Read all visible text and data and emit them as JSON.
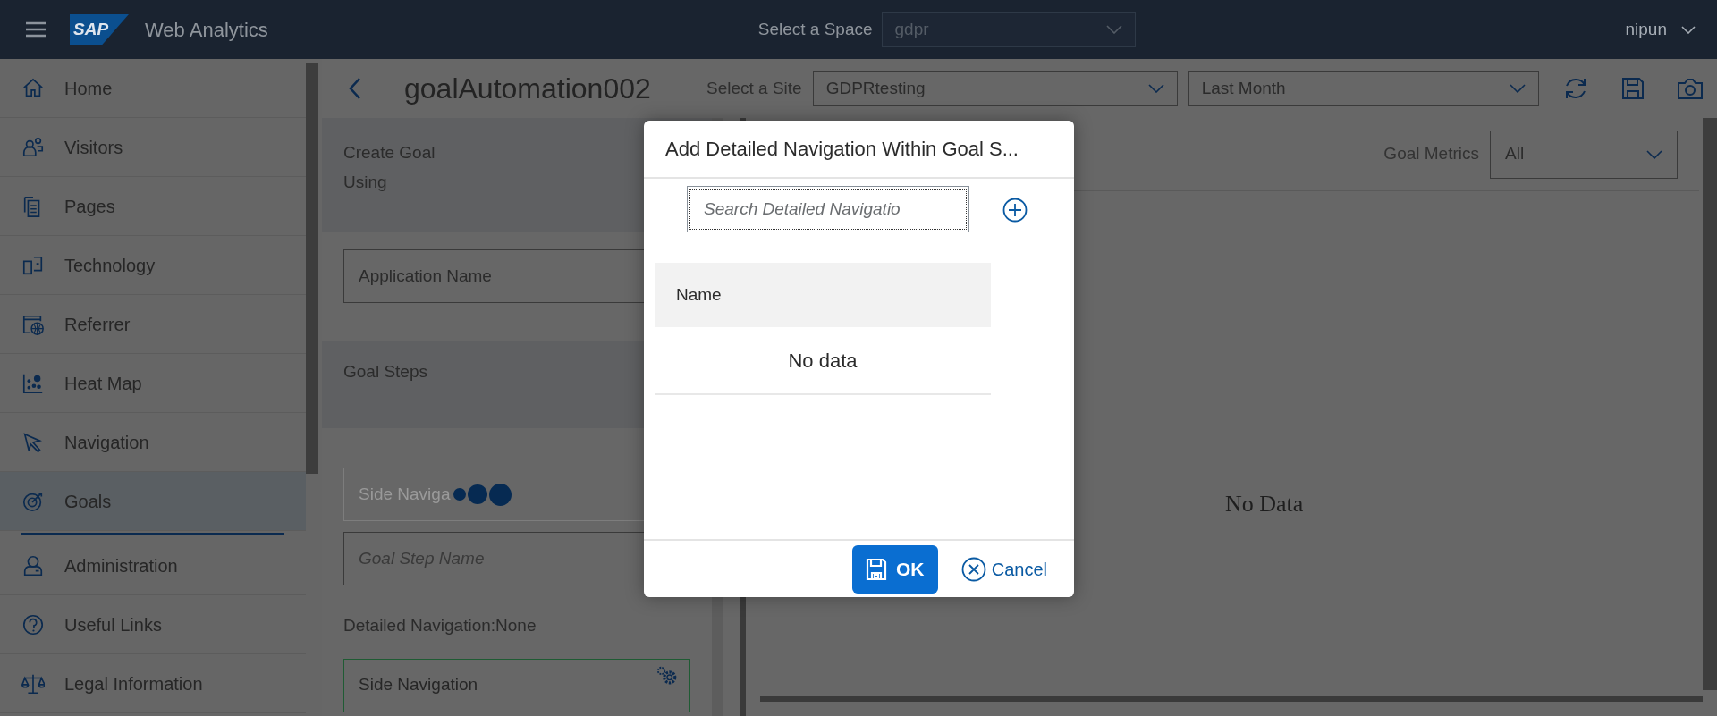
{
  "header": {
    "logo": "SAP",
    "app_title": "Web Analytics",
    "space_label": "Select a Space",
    "space_value": "gdpr",
    "user": "nipun"
  },
  "sidebar": {
    "items": [
      {
        "label": "Home",
        "selected": false
      },
      {
        "label": "Visitors",
        "selected": false
      },
      {
        "label": "Pages",
        "selected": false
      },
      {
        "label": "Technology",
        "selected": false
      },
      {
        "label": "Referrer",
        "selected": false
      },
      {
        "label": "Heat Map",
        "selected": false
      },
      {
        "label": "Navigation",
        "selected": false
      },
      {
        "label": "Goals",
        "selected": true
      }
    ],
    "bottom_items": [
      {
        "label": "Administration",
        "selected": false
      },
      {
        "label": "Useful Links",
        "selected": false
      },
      {
        "label": "Legal Information",
        "selected": false
      }
    ]
  },
  "toolbar": {
    "title": "goalAutomation002",
    "site_label": "Select a Site",
    "site_value": "GDPRtesting",
    "period_value": "Last Month"
  },
  "form": {
    "section_title": "Create Goal Using",
    "application_field": "Application Name",
    "steps_title": "Goal Steps",
    "step_field": {
      "value": "Side Naviga",
      "disabled": true,
      "loading": true
    },
    "step_name": {
      "placeholder": "Goal Step Name"
    },
    "detailed_navigation": "Detailed Navigation:None",
    "next_step": {
      "value": "Side Navigation",
      "disabled": false
    }
  },
  "right": {
    "metrics_label": "Goal Metrics",
    "metrics_value": "All",
    "empty": "No Data"
  },
  "dialog": {
    "title": "Add Detailed Navigation Within Goal S...",
    "search": {
      "placeholder": "Search Detailed Navigatio"
    },
    "columns": [
      "Name"
    ],
    "empty": "No data",
    "ok": "OK",
    "cancel": "Cancel"
  }
}
